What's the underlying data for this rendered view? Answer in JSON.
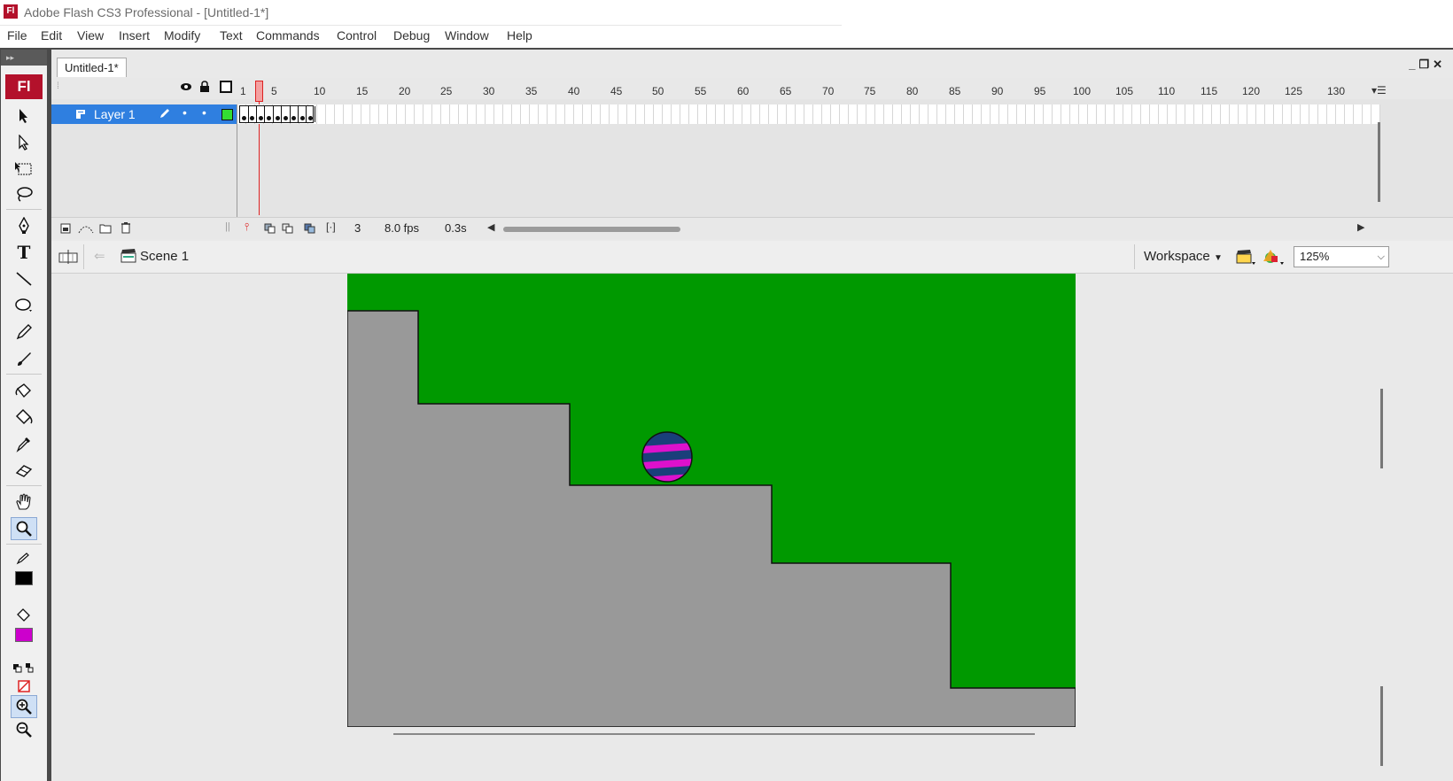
{
  "window": {
    "title": "Adobe Flash CS3 Professional - [Untitled-1*]",
    "logo_text": "Fl"
  },
  "menubar": {
    "items": [
      "File",
      "Edit",
      "View",
      "Insert",
      "Modify",
      "Text",
      "Commands",
      "Control",
      "Debug",
      "Window",
      "Help"
    ]
  },
  "toolbox": {
    "logo_text": "Fl",
    "stroke_color": "#000000",
    "fill_color": "#cc00cc"
  },
  "document": {
    "tab_label": "Untitled-1*"
  },
  "timeline": {
    "ruler_labels": [
      "1",
      "5",
      "10",
      "15",
      "20",
      "25",
      "30",
      "35",
      "40",
      "45",
      "50",
      "55",
      "60",
      "65",
      "70",
      "75",
      "80",
      "85",
      "90",
      "95",
      "100",
      "105",
      "110",
      "115",
      "120",
      "125",
      "130"
    ],
    "layer_name": "Layer 1",
    "current_frame": "3",
    "frame_rate": "8.0 fps",
    "elapsed_time": "0.3s",
    "keyframe_count": 9
  },
  "editbar": {
    "scene_label": "Scene 1",
    "workspace_label": "Workspace",
    "zoom_value": "125%"
  },
  "stage": {
    "background_color": "#009900",
    "ground_color": "#999999",
    "ball_colors": [
      "#1a3f7a",
      "#dd11cc"
    ]
  }
}
